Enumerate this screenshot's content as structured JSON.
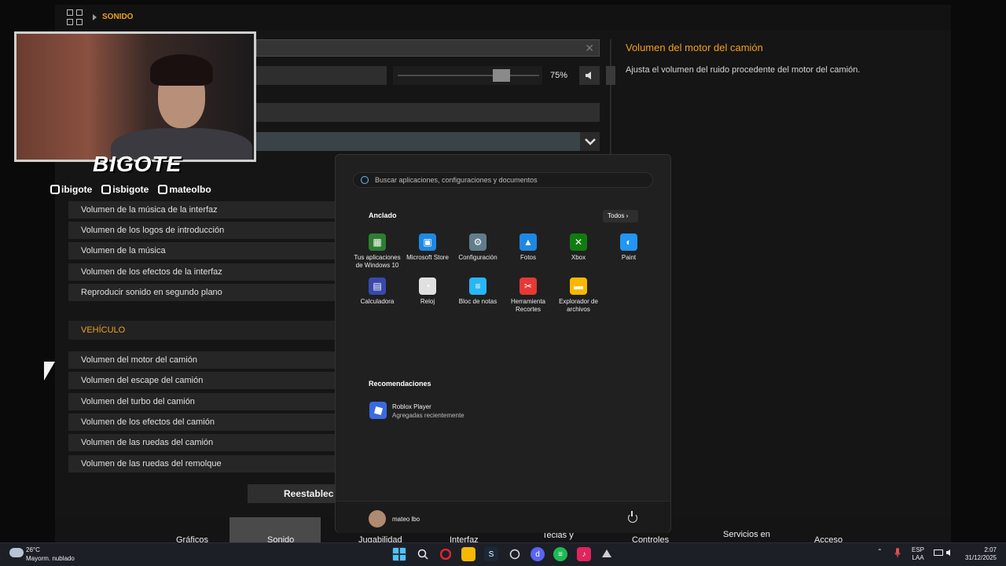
{
  "game": {
    "breadcrumb": "SONIDO",
    "slider": {
      "value_label": "75%",
      "level": 0.75
    },
    "help": {
      "title": "Volumen del motor del camión",
      "text": "Ajusta el volumen del ruido procedente del motor del camión."
    },
    "interface_rows": [
      "Volumen de la música de la interfaz",
      "Volumen de los logos de introducción",
      "Volumen de la música",
      "Volumen de los efectos de la interfaz",
      "Reproducir sonido en segundo plano"
    ],
    "section_vehicle": "VEHÍCULO",
    "vehicle_rows": [
      "Volumen del motor del camión",
      "Volumen del escape del camión",
      "Volumen del turbo del camión",
      "Volumen de los efectos del camión",
      "Volumen de las ruedas del camión",
      "Volumen de las ruedas del remolque"
    ],
    "reset_label": "Reestablec",
    "bottom_nav": {
      "graphics": "Gráficos",
      "sound": "Sonido",
      "gameplay": "Jugabilidad",
      "interface": "Interfaz",
      "keys": "Teclas y",
      "controls": "Controles",
      "services": "Servicios en",
      "access": "Acceso"
    }
  },
  "webcam": {
    "brand": "BIGOTE",
    "twitch": "ibigote",
    "tiktok": "isbigote",
    "instagram": "mateolbo"
  },
  "start_menu": {
    "search_placeholder": "Buscar aplicaciones, configuraciones y documentos",
    "pinned_title": "Anclado",
    "all_label": "Todos",
    "apps": [
      {
        "line1": "Tus aplicaciones",
        "line2": "de Windows 10",
        "icon": "apps-grid-icon",
        "color": "#2e7d32"
      },
      {
        "line1": "Microsoft Store",
        "line2": "",
        "icon": "store-icon",
        "color": "#1e88e5"
      },
      {
        "line1": "Configuración",
        "line2": "",
        "icon": "gear-icon",
        "color": "#607d8b"
      },
      {
        "line1": "Fotos",
        "line2": "",
        "icon": "photos-icon",
        "color": "#1e88e5"
      },
      {
        "line1": "Xbox",
        "line2": "",
        "icon": "xbox-icon",
        "color": "#107c10"
      },
      {
        "line1": "Paint",
        "line2": "",
        "icon": "paint-icon",
        "color": "#2196f3"
      },
      {
        "line1": "Calculadora",
        "line2": "",
        "icon": "calculator-icon",
        "color": "#3949ab"
      },
      {
        "line1": "Reloj",
        "line2": "",
        "icon": "clock-icon",
        "color": "#e0e0e0"
      },
      {
        "line1": "Bloc de notas",
        "line2": "",
        "icon": "notepad-icon",
        "color": "#29b6f6"
      },
      {
        "line1": "Herramienta",
        "line2": "Recortes",
        "icon": "snipping-icon",
        "color": "#e53935"
      },
      {
        "line1": "Explorador de",
        "line2": "archivos",
        "icon": "folder-icon",
        "color": "#f9b800"
      }
    ],
    "recommended_title": "Recomendaciones",
    "recommended": {
      "name": "Roblox Player",
      "sub": "Agregadas recientemente"
    },
    "user": "mateo lbo"
  },
  "taskbar": {
    "weather_temp": "26°C",
    "weather_desc": "Mayorm. nublado",
    "lang1": "ESP",
    "lang2": "LAA",
    "time": "2:07",
    "date": "31/12/2025"
  },
  "colors": {
    "accent": "#f0a020",
    "start_bg": "#202020",
    "taskbar": "#1c1f26"
  }
}
